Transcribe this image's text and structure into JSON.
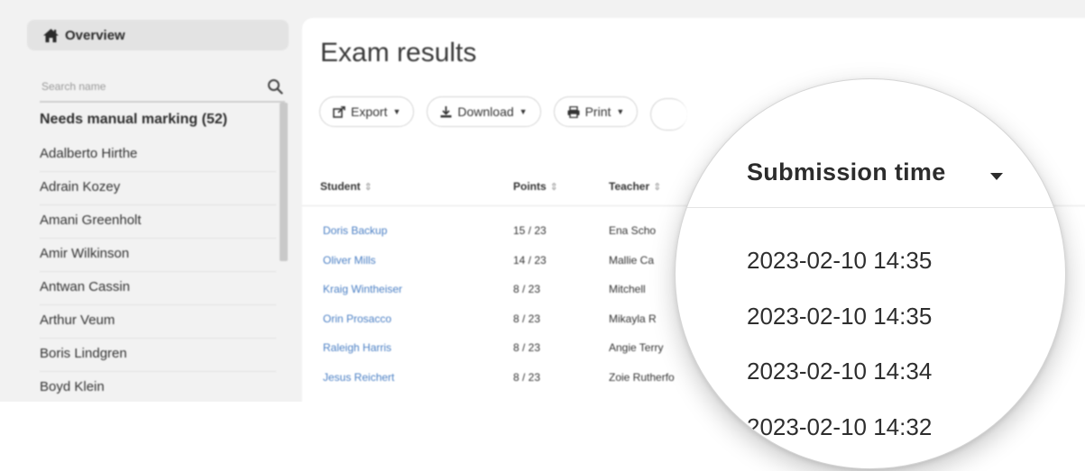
{
  "sidebar": {
    "overview_label": "Overview",
    "search_placeholder": "Search name",
    "group_heading": "Needs manual marking (52)",
    "names": [
      "Adalberto Hirthe",
      "Adrain Kozey",
      "Amani Greenholt",
      "Amir Wilkinson",
      "Antwan Cassin",
      "Arthur Veum",
      "Boris Lindgren",
      "Boyd Klein"
    ]
  },
  "main": {
    "title": "Exam results",
    "toolbar": {
      "export_label": "Export",
      "download_label": "Download",
      "print_label": "Print"
    },
    "columns": {
      "student": "Student",
      "points": "Points",
      "teacher": "Teacher",
      "submission_time": "Submission time"
    },
    "rows": [
      {
        "student": "Doris Backup",
        "points": "15 / 23",
        "teacher": "Ena Scho",
        "time": "2023-02-10 14:35"
      },
      {
        "student": "Oliver Mills",
        "points": "14 / 23",
        "teacher": "Mallie Ca",
        "time": "2023-02-10 14:35"
      },
      {
        "student": "Kraig Wintheiser",
        "points": "8 / 23",
        "teacher": "Mitchell",
        "time": "2023-02-10 14:34"
      },
      {
        "student": "Orin Prosacco",
        "points": "8 / 23",
        "teacher": "Mikayla R",
        "time": "2023-02-10 14:32"
      },
      {
        "student": "Raleigh Harris",
        "points": "8 / 23",
        "teacher": "Angie Terry",
        "time": ""
      },
      {
        "student": "Jesus Reichert",
        "points": "8 / 23",
        "teacher": "Zoie Rutherfo",
        "time": ""
      }
    ]
  },
  "icons": {
    "home": "home-icon",
    "search": "search-icon",
    "export": "export-icon",
    "download": "download-icon",
    "print": "print-icon",
    "sort": "sort-icon",
    "sort_desc": "caret-down-icon",
    "filter": "filter-icon"
  },
  "colors": {
    "link": "#4a7fc4",
    "sidebar_bg": "#f2f2f2",
    "active_item_bg": "#e3e3e3"
  }
}
